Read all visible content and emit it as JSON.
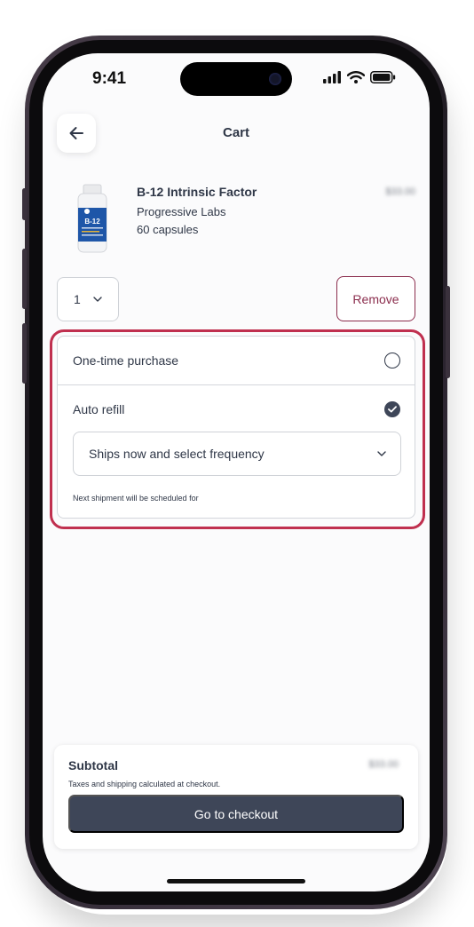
{
  "status_bar": {
    "time": "9:41"
  },
  "header": {
    "title": "Cart"
  },
  "product": {
    "name": "B-12 Intrinsic Factor",
    "brand": "Progressive Labs",
    "count": "60 capsules",
    "price": "$33.00",
    "image_label": "B-12"
  },
  "quantity": {
    "value": "1"
  },
  "remove_label": "Remove",
  "purchase_options": {
    "one_time_label": "One-time purchase",
    "auto_refill_label": "Auto refill",
    "selected": "auto_refill",
    "frequency_placeholder": "Ships now and select frequency",
    "next_shipment_text": "Next shipment will be scheduled for"
  },
  "footer": {
    "subtotal_label": "Subtotal",
    "subtotal_value": "$33.00",
    "taxes_note": "Taxes and shipping calculated at checkout.",
    "checkout_label": "Go to checkout"
  },
  "colors": {
    "accent": "#3e4658",
    "remove": "#8b2d4d",
    "highlight": "#c0304f",
    "text": "#2f3747"
  },
  "icons": {
    "back": "arrow-left-icon",
    "chevron": "chevron-down-icon",
    "radio_empty": "radio-unchecked-icon",
    "radio_checked": "checkmark-circle-icon"
  }
}
